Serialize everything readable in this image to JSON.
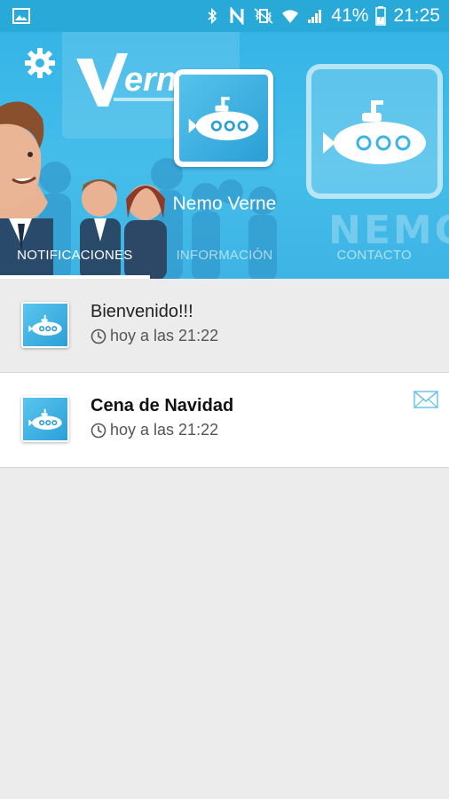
{
  "status_bar": {
    "battery": "41%",
    "time": "21:25"
  },
  "header": {
    "user_name": "Nemo Verne",
    "brand_word": "NEMO",
    "logo_text": "Verne"
  },
  "tabs": [
    {
      "label": "NOTIFICACIONES",
      "active": true
    },
    {
      "label": "INFORMACIÓN",
      "active": false
    },
    {
      "label": "CONTACTO",
      "active": false
    }
  ],
  "notifications": [
    {
      "title": "Bienvenido!!!",
      "time": "hoy a las 21:22",
      "read": true
    },
    {
      "title": "Cena de Navidad",
      "time": "hoy a las 21:22",
      "read": false
    }
  ],
  "colors": {
    "accent": "#35b5e6",
    "status_bar": "#28a9d8"
  }
}
